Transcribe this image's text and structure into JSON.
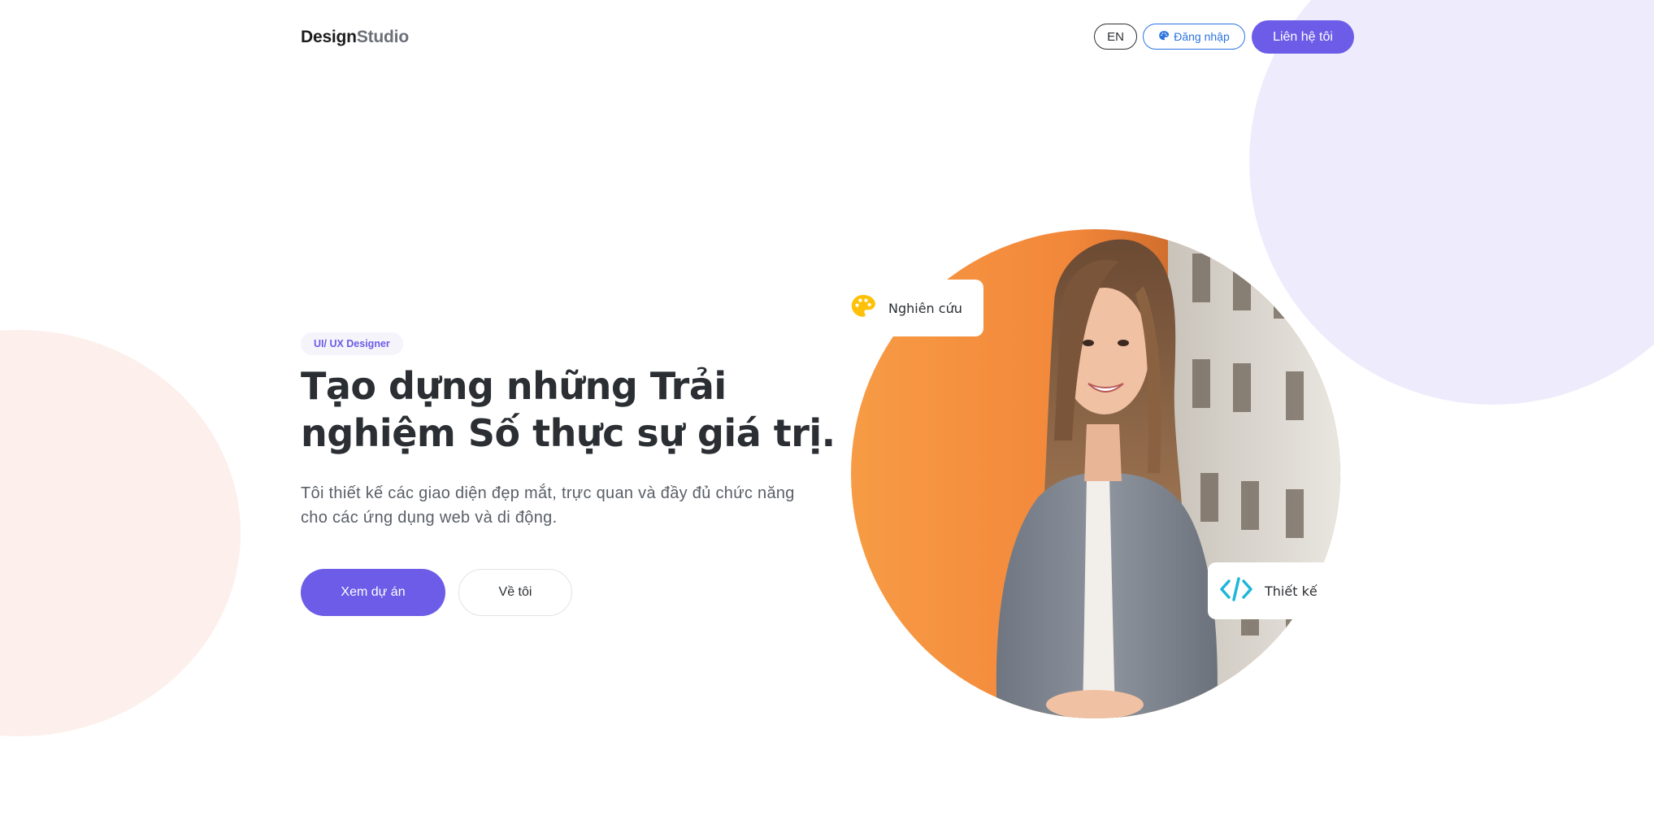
{
  "brand": {
    "part1": "Design",
    "part2": "Studio"
  },
  "header": {
    "lang_label": "EN",
    "login_label": "Đăng nhập",
    "contact_label": "Liên hệ tôi"
  },
  "hero": {
    "badge": "UI/ UX Designer",
    "headline_line1": "Tạo dựng những Trải",
    "headline_line2": "nghiệm Số thực sự giá trị.",
    "description_line1": "Tôi thiết kế các giao diện đẹp mắt, trực quan và đầy đủ chức năng",
    "description_line2": "cho các ứng dụng web và di động.",
    "primary_button": "Xem dự án",
    "secondary_button": "Về tôi"
  },
  "cards": {
    "research": {
      "label": "Nghiên cứu",
      "icon": "palette-icon"
    },
    "design": {
      "label": "Thiết kế",
      "icon": "code-icon"
    }
  },
  "colors": {
    "accent": "#6c5ce7",
    "login_blue": "#2b73e0",
    "palette_yellow": "#ffc107",
    "code_cyan": "#1fb6d9",
    "portrait_orange": "#f28a3a",
    "bg_circle_pink": "#fcefec",
    "bg_circle_lavender": "#eeecfc"
  }
}
